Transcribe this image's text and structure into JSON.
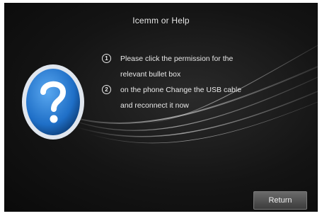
{
  "dialog": {
    "title": "Icemm or Help"
  },
  "instructions": [
    {
      "number": "1",
      "text": "Please click the permission for the relevant bullet box"
    },
    {
      "number": "2",
      "text": "on the phone Change the USB cable and reconnect it now"
    }
  ],
  "buttons": {
    "return_label": "Return"
  },
  "icons": {
    "help": "question-mark-icon"
  },
  "colors": {
    "background": "#141414",
    "badge_blue": "#1f6fc7",
    "text": "#e8e8e8"
  }
}
